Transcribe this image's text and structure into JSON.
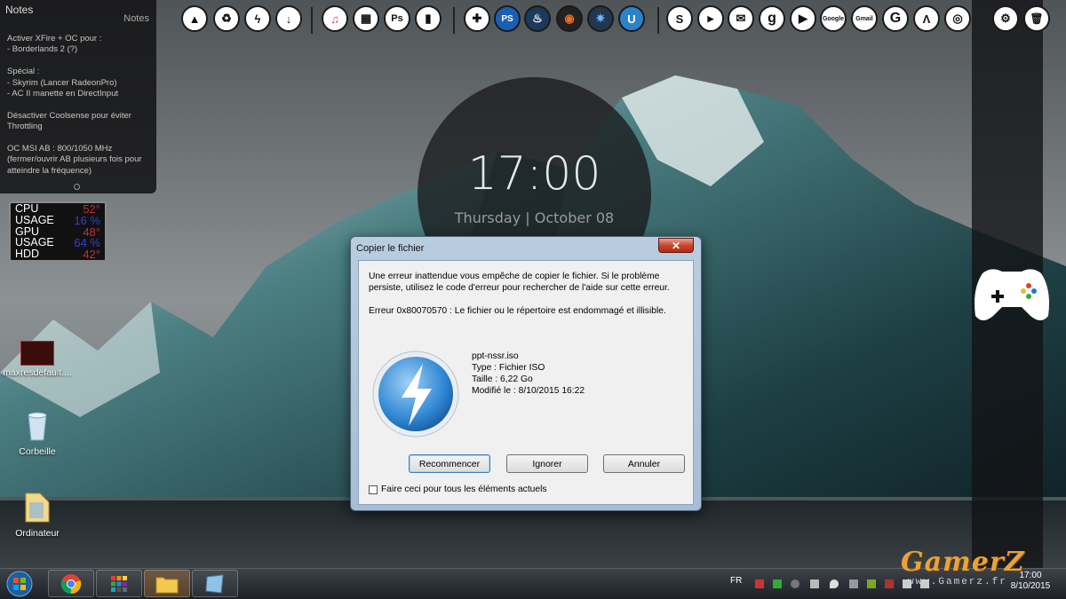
{
  "notes": {
    "title": "Notes",
    "heading": "Notes",
    "body": "Activer XFire + OC pour :\n- Borderlands 2 (?)\n\nSpécial :\n- Skyrim (Lancer RadeonPro)\n- AC II manette en DirectInput\n\nDésactiver Coolsense pour éviter Throttling\n\nOC MSI AB : 800/1050 MHz\n(fermer/ouvrir AB plusieurs fois pour atteindre la fréquence)"
  },
  "sysmon": {
    "rows": [
      {
        "label": "CPU",
        "value": "52°",
        "color": "#c0303a"
      },
      {
        "label": "USAGE",
        "value": "16 %",
        "color": "#3b3bdc"
      },
      {
        "label": "GPU",
        "value": "48°",
        "color": "#c0303a"
      },
      {
        "label": "USAGE",
        "value": "64 %",
        "color": "#3b3bdc"
      },
      {
        "label": "HDD",
        "value": "42°",
        "color": "#c0303a"
      }
    ]
  },
  "clock": {
    "time": "17:00",
    "date": "Thursday | October 08"
  },
  "dock": {
    "icons": [
      {
        "name": "warning-icon",
        "glyph": "▲"
      },
      {
        "name": "recycle-icon",
        "glyph": "♻"
      },
      {
        "name": "lightning-icon",
        "glyph": "ϟ"
      },
      {
        "name": "download-icon",
        "glyph": "↓"
      },
      {
        "name": "itunes-icon",
        "glyph": "♫"
      },
      {
        "name": "calculator-icon",
        "glyph": "▦"
      },
      {
        "name": "photoshop-icon",
        "glyph": "Ps"
      },
      {
        "name": "book-icon",
        "glyph": "▮"
      },
      {
        "name": "gamepad-icon",
        "glyph": "✚"
      },
      {
        "name": "playstation-icon",
        "glyph": "PS"
      },
      {
        "name": "steam-icon",
        "glyph": "♨"
      },
      {
        "name": "origin-icon",
        "glyph": "◉"
      },
      {
        "name": "battlenet-icon",
        "glyph": "✷"
      },
      {
        "name": "uplay-icon",
        "glyph": "U"
      },
      {
        "name": "skype-icon",
        "glyph": "S"
      },
      {
        "name": "youtube-icon",
        "glyph": "▶"
      },
      {
        "name": "mail-icon",
        "glyph": "✉"
      },
      {
        "name": "google-icon",
        "glyph": "g"
      },
      {
        "name": "play-icon",
        "glyph": "▶"
      },
      {
        "name": "google-search-icon",
        "glyph": "Google"
      },
      {
        "name": "gmail-icon",
        "glyph": "Gmail"
      },
      {
        "name": "g-icon",
        "glyph": "G"
      },
      {
        "name": "arch-icon",
        "glyph": "Λ"
      },
      {
        "name": "chrome-icon",
        "glyph": "◎"
      },
      {
        "name": "settings-icon",
        "glyph": "⚙"
      },
      {
        "name": "trash-icon",
        "glyph": "🗑"
      }
    ]
  },
  "desktop": {
    "icons": [
      {
        "label": "maxresdefault...."
      },
      {
        "label": "Corbeille"
      },
      {
        "label": "Ordinateur"
      }
    ]
  },
  "dialog": {
    "title": "Copier le fichier",
    "close_label": "✕",
    "message": "Une erreur inattendue vous empêche de copier le fichier. Si le problème persiste, utilisez le code d'erreur pour rechercher de l'aide sur cette erreur.",
    "error": "Erreur 0x80070570 : Le fichier ou le répertoire est endommagé et illisible.",
    "file": {
      "name": "ppt-nssr.iso",
      "type": "Type : Fichier ISO",
      "size": "Taille : 6,22 Go",
      "modified": "Modifié le : 8/10/2015 16:22"
    },
    "buttons": {
      "retry": "Recommencer",
      "ignore": "Ignorer",
      "cancel": "Annuler"
    },
    "checkbox_label": "Faire ceci pour tous les éléments actuels"
  },
  "taskbar": {
    "language": "FR",
    "time": "17:00",
    "date": "8/10/2015"
  },
  "watermark": {
    "brand": "GamerZ",
    "url": "www.Gamerz.fr"
  },
  "colors": {
    "accent": "#3c7fb1",
    "close": "#c7412a",
    "watermark": "#e8a33a"
  }
}
